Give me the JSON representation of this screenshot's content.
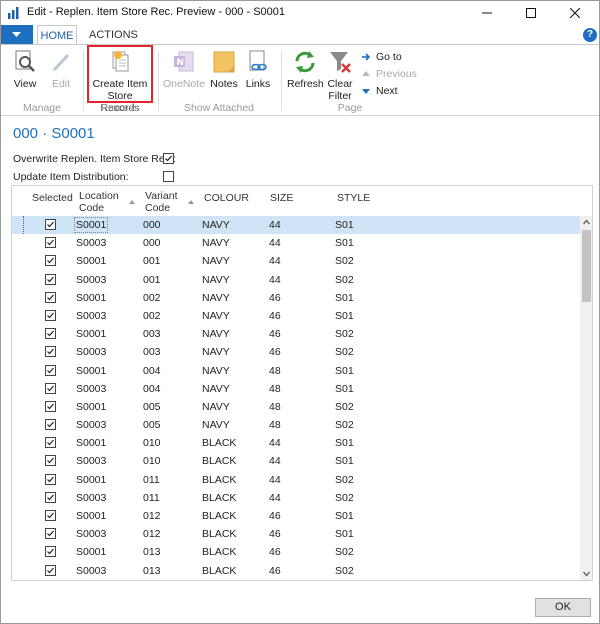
{
  "window": {
    "title": "Edit - Replen. Item Store Rec. Preview - 000 - S0001",
    "minimize": "—",
    "maximize": "☐",
    "close": "✕"
  },
  "ribbon": {
    "tabs": [
      "HOME",
      "ACTIONS"
    ],
    "help": "?",
    "groups": {
      "manage": "Manage",
      "process": "Process",
      "show_attached": "Show Attached",
      "page": "Page"
    },
    "buttons": {
      "view": "View",
      "edit": "Edit",
      "create_line1": "Create Item",
      "create_line2": "Store Records",
      "onenote": "OneNote",
      "notes": "Notes",
      "links": "Links",
      "refresh": "Refresh",
      "clear_line1": "Clear",
      "clear_line2": "Filter",
      "goto": "Go to",
      "previous": "Previous",
      "next": "Next"
    }
  },
  "page": {
    "title": "000 · S0001",
    "fields": {
      "overwrite_label": "Overwrite Replen. Item Store Rec.:",
      "overwrite_checked": true,
      "update_label": "Update Item Distribution:",
      "update_checked": false
    }
  },
  "grid": {
    "headers": {
      "selected": "Selected",
      "location_line1": "Location",
      "location_line2": "Code",
      "variant_line1": "Variant",
      "variant_line2": "Code",
      "colour": "COLOUR",
      "size": "SIZE",
      "style": "STYLE"
    },
    "rows": [
      {
        "selected": true,
        "location": "S0001",
        "variant": "000",
        "colour": "NAVY",
        "size": "44",
        "style": "S01"
      },
      {
        "selected": true,
        "location": "S0003",
        "variant": "000",
        "colour": "NAVY",
        "size": "44",
        "style": "S01"
      },
      {
        "selected": true,
        "location": "S0001",
        "variant": "001",
        "colour": "NAVY",
        "size": "44",
        "style": "S02"
      },
      {
        "selected": true,
        "location": "S0003",
        "variant": "001",
        "colour": "NAVY",
        "size": "44",
        "style": "S02"
      },
      {
        "selected": true,
        "location": "S0001",
        "variant": "002",
        "colour": "NAVY",
        "size": "46",
        "style": "S01"
      },
      {
        "selected": true,
        "location": "S0003",
        "variant": "002",
        "colour": "NAVY",
        "size": "46",
        "style": "S01"
      },
      {
        "selected": true,
        "location": "S0001",
        "variant": "003",
        "colour": "NAVY",
        "size": "46",
        "style": "S02"
      },
      {
        "selected": true,
        "location": "S0003",
        "variant": "003",
        "colour": "NAVY",
        "size": "46",
        "style": "S02"
      },
      {
        "selected": true,
        "location": "S0001",
        "variant": "004",
        "colour": "NAVY",
        "size": "48",
        "style": "S01"
      },
      {
        "selected": true,
        "location": "S0003",
        "variant": "004",
        "colour": "NAVY",
        "size": "48",
        "style": "S01"
      },
      {
        "selected": true,
        "location": "S0001",
        "variant": "005",
        "colour": "NAVY",
        "size": "48",
        "style": "S02"
      },
      {
        "selected": true,
        "location": "S0003",
        "variant": "005",
        "colour": "NAVY",
        "size": "48",
        "style": "S02"
      },
      {
        "selected": true,
        "location": "S0001",
        "variant": "010",
        "colour": "BLACK",
        "size": "44",
        "style": "S01"
      },
      {
        "selected": true,
        "location": "S0003",
        "variant": "010",
        "colour": "BLACK",
        "size": "44",
        "style": "S01"
      },
      {
        "selected": true,
        "location": "S0001",
        "variant": "011",
        "colour": "BLACK",
        "size": "44",
        "style": "S02"
      },
      {
        "selected": true,
        "location": "S0003",
        "variant": "011",
        "colour": "BLACK",
        "size": "44",
        "style": "S02"
      },
      {
        "selected": true,
        "location": "S0001",
        "variant": "012",
        "colour": "BLACK",
        "size": "46",
        "style": "S01"
      },
      {
        "selected": true,
        "location": "S0003",
        "variant": "012",
        "colour": "BLACK",
        "size": "46",
        "style": "S01"
      },
      {
        "selected": true,
        "location": "S0001",
        "variant": "013",
        "colour": "BLACK",
        "size": "46",
        "style": "S02"
      },
      {
        "selected": true,
        "location": "S0003",
        "variant": "013",
        "colour": "BLACK",
        "size": "46",
        "style": "S02"
      }
    ]
  },
  "footer": {
    "ok": "OK"
  },
  "colors": {
    "accent": "#1f6fc1",
    "highlight_border": "#e0262b",
    "selected_row": "#cfe4f7"
  }
}
